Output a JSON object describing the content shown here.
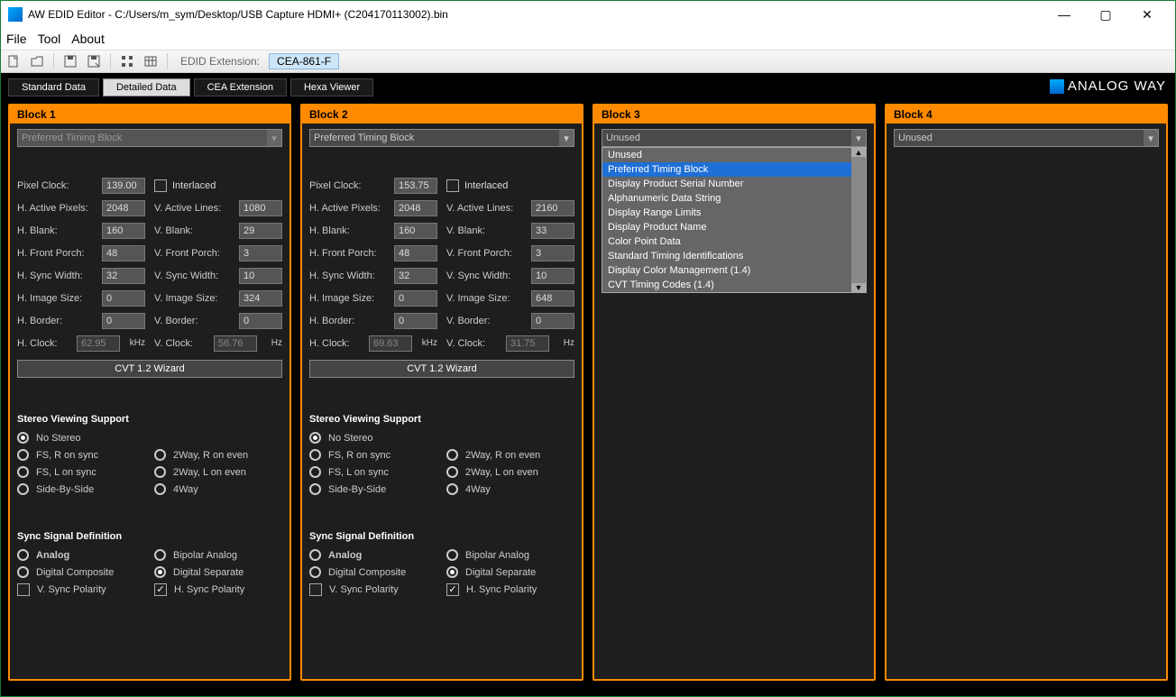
{
  "window": {
    "title": "AW EDID Editor - C:/Users/m_sym/Desktop/USB Capture HDMI+ (C204170113002).bin"
  },
  "menu": {
    "file": "File",
    "tool": "Tool",
    "about": "About"
  },
  "toolbar": {
    "ext_label": "EDID Extension:",
    "ext_btn": "CEA-861-F"
  },
  "brand": "ANALOG WAY",
  "tabs": {
    "std": "Standard Data",
    "det": "Detailed Data",
    "cea": "CEA Extension",
    "hex": "Hexa Viewer"
  },
  "labels": {
    "pixel_clock": "Pixel Clock:",
    "interlaced": "Interlaced",
    "h_active": "H. Active Pixels:",
    "v_active": "V. Active Lines:",
    "h_blank": "H. Blank:",
    "v_blank": "V. Blank:",
    "h_fp": "H. Front Porch:",
    "v_fp": "V. Front Porch:",
    "h_sw": "H. Sync Width:",
    "v_sw": "V. Sync Width:",
    "h_img": "H. Image Size:",
    "v_img": "V. Image Size:",
    "h_border": "H. Border:",
    "v_border": "V. Border:",
    "h_clock": "H. Clock:",
    "v_clock": "V. Clock:",
    "khz": "kHz",
    "hz": "Hz",
    "wizard": "CVT 1.2 Wizard",
    "stereo_h": "Stereo Viewing Support",
    "no_stereo": "No Stereo",
    "fs_r": "FS, R on sync",
    "w2_r": "2Way, R on even",
    "fs_l": "FS, L on sync",
    "w2_l": "2Way, L on even",
    "sbs": "Side-By-Side",
    "w4": "4Way",
    "sync_h": "Sync Signal Definition",
    "analog": "Analog",
    "bipolar": "Bipolar Analog",
    "dc": "Digital Composite",
    "ds": "Digital Separate",
    "vpol": "V. Sync Polarity",
    "hpol": "H. Sync Polarity"
  },
  "blocks": {
    "b1": {
      "title": "Block 1",
      "type": "Preferred Timing Block",
      "pixel_clock": "139.00",
      "interlaced": false,
      "h_active": "2048",
      "v_active": "1080",
      "h_blank": "160",
      "v_blank": "29",
      "h_fp": "48",
      "v_fp": "3",
      "h_sw": "32",
      "v_sw": "10",
      "h_img": "0",
      "v_img": "324",
      "h_border": "0",
      "v_border": "0",
      "h_clock": "62.95",
      "v_clock": "56.76",
      "hpol": true,
      "vpol": false
    },
    "b2": {
      "title": "Block 2",
      "type": "Preferred Timing Block",
      "pixel_clock": "153.75",
      "interlaced": false,
      "h_active": "2048",
      "v_active": "2160",
      "h_blank": "160",
      "v_blank": "33",
      "h_fp": "48",
      "v_fp": "3",
      "h_sw": "32",
      "v_sw": "10",
      "h_img": "0",
      "v_img": "648",
      "h_border": "0",
      "v_border": "0",
      "h_clock": "69.63",
      "v_clock": "31.75",
      "hpol": true,
      "vpol": false
    },
    "b3": {
      "title": "Block 3",
      "type": "Unused",
      "dropdown": [
        "Unused",
        "Preferred Timing Block",
        "Display Product Serial Number",
        "Alphanumeric Data String",
        "Display Range Limits",
        "Display Product Name",
        "Color Point Data",
        "Standard Timing Identifications",
        "Display Color Management (1.4)",
        "CVT Timing Codes (1.4)"
      ],
      "highlight_index": 1
    },
    "b4": {
      "title": "Block 4",
      "type": "Unused"
    }
  }
}
